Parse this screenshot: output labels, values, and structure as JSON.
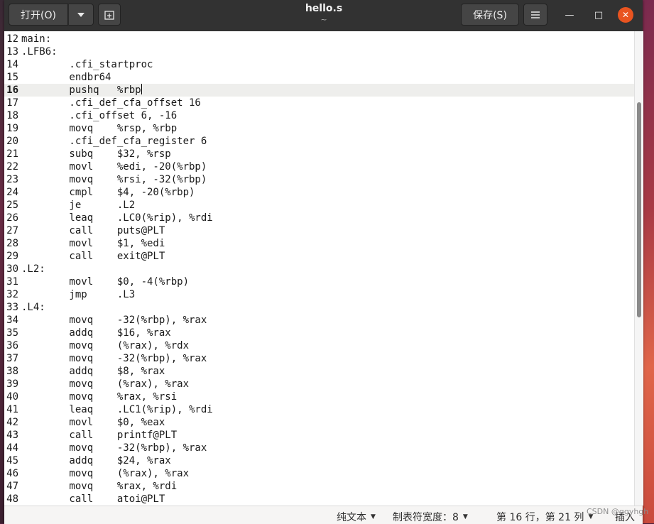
{
  "window": {
    "title": "hello.s",
    "subtitle": "~"
  },
  "toolbar": {
    "open_label": "打开(O)",
    "open_menu_icon": "chevron-down-icon",
    "new_tab_icon": "new-tab-icon",
    "save_label": "保存(S)",
    "menu_icon": "hamburger-icon"
  },
  "window_controls": {
    "minimize": "—",
    "maximize": "□",
    "close": "✕"
  },
  "editor": {
    "current_line": 16,
    "lines": [
      {
        "n": "12",
        "text": "main:"
      },
      {
        "n": "13",
        "text": ".LFB6:"
      },
      {
        "n": "14",
        "text": "\t.cfi_startproc"
      },
      {
        "n": "15",
        "text": "\tendbr64"
      },
      {
        "n": "16",
        "text": "\tpushq\t%rbp"
      },
      {
        "n": "17",
        "text": "\t.cfi_def_cfa_offset 16"
      },
      {
        "n": "18",
        "text": "\t.cfi_offset 6, -16"
      },
      {
        "n": "19",
        "text": "\tmovq\t%rsp, %rbp"
      },
      {
        "n": "20",
        "text": "\t.cfi_def_cfa_register 6"
      },
      {
        "n": "21",
        "text": "\tsubq\t$32, %rsp"
      },
      {
        "n": "22",
        "text": "\tmovl\t%edi, -20(%rbp)"
      },
      {
        "n": "23",
        "text": "\tmovq\t%rsi, -32(%rbp)"
      },
      {
        "n": "24",
        "text": "\tcmpl\t$4, -20(%rbp)"
      },
      {
        "n": "25",
        "text": "\tje\t.L2"
      },
      {
        "n": "26",
        "text": "\tleaq\t.LC0(%rip), %rdi"
      },
      {
        "n": "27",
        "text": "\tcall\tputs@PLT"
      },
      {
        "n": "28",
        "text": "\tmovl\t$1, %edi"
      },
      {
        "n": "29",
        "text": "\tcall\texit@PLT"
      },
      {
        "n": "30",
        "text": ".L2:"
      },
      {
        "n": "31",
        "text": "\tmovl\t$0, -4(%rbp)"
      },
      {
        "n": "32",
        "text": "\tjmp\t.L3"
      },
      {
        "n": "33",
        "text": ".L4:"
      },
      {
        "n": "34",
        "text": "\tmovq\t-32(%rbp), %rax"
      },
      {
        "n": "35",
        "text": "\taddq\t$16, %rax"
      },
      {
        "n": "36",
        "text": "\tmovq\t(%rax), %rdx"
      },
      {
        "n": "37",
        "text": "\tmovq\t-32(%rbp), %rax"
      },
      {
        "n": "38",
        "text": "\taddq\t$8, %rax"
      },
      {
        "n": "39",
        "text": "\tmovq\t(%rax), %rax"
      },
      {
        "n": "40",
        "text": "\tmovq\t%rax, %rsi"
      },
      {
        "n": "41",
        "text": "\tleaq\t.LC1(%rip), %rdi"
      },
      {
        "n": "42",
        "text": "\tmovl\t$0, %eax"
      },
      {
        "n": "43",
        "text": "\tcall\tprintf@PLT"
      },
      {
        "n": "44",
        "text": "\tmovq\t-32(%rbp), %rax"
      },
      {
        "n": "45",
        "text": "\taddq\t$24, %rax"
      },
      {
        "n": "46",
        "text": "\tmovq\t(%rax), %rax"
      },
      {
        "n": "47",
        "text": "\tmovq\t%rax, %rdi"
      },
      {
        "n": "48",
        "text": "\tcall\tatoi@PLT"
      }
    ]
  },
  "statusbar": {
    "syntax": "纯文本",
    "tab_width": "制表符宽度：8",
    "position": "第 16 行，第 21 列",
    "insert_mode": "插入",
    "watermark": "CSDN @ggyhgh"
  },
  "colors": {
    "titlebar": "#323232",
    "close_accent": "#e95420",
    "current_line_bg": "#eeeeec"
  }
}
